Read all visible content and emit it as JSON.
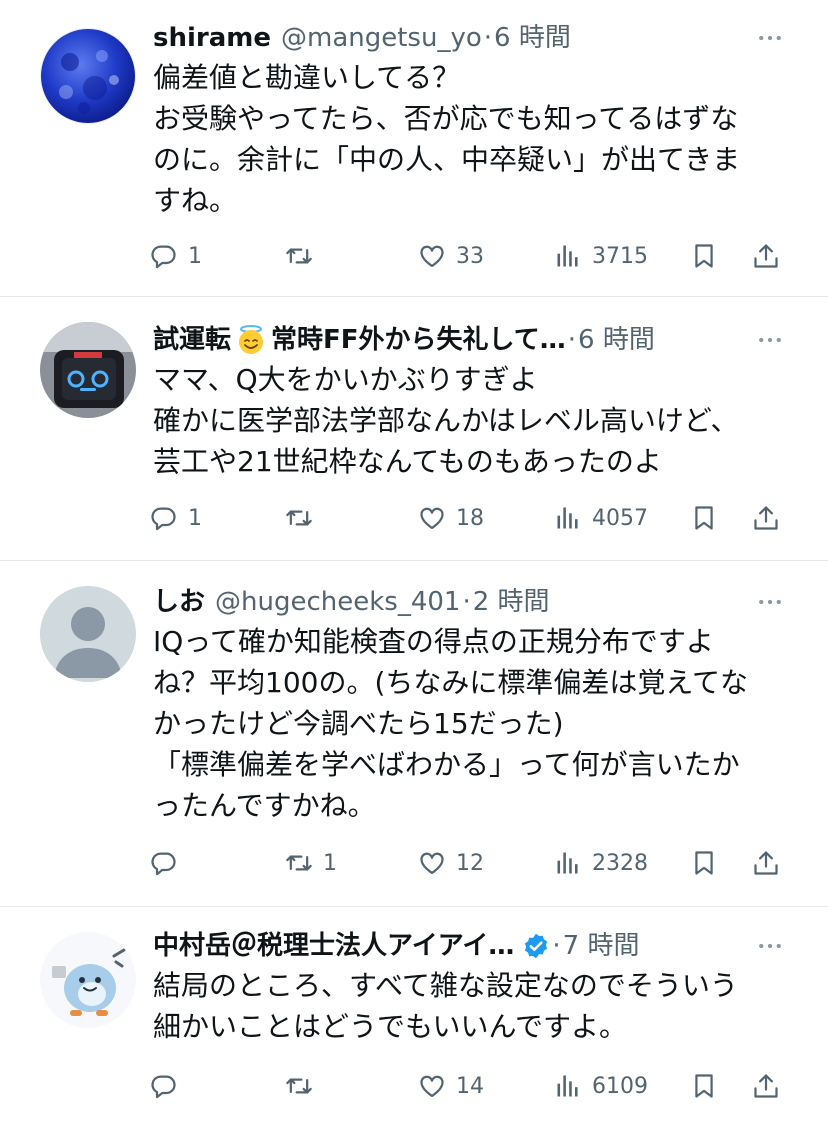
{
  "tweets": [
    {
      "name": "shirame",
      "handle": "@mangetsu_yo",
      "sep": "·",
      "time": "6 時間",
      "avatar_icon": "moon-avatar",
      "lines": [
        "偏差値と勘違いしてる？",
        "お受験やってたら、否が応でも知ってるはずな",
        "のに。余計に「中の人、中卒疑い」が出てきま",
        "すね。"
      ],
      "replies": "1",
      "retweets": "",
      "likes": "33",
      "views": "3715"
    },
    {
      "name": "試運転",
      "name_suffix": "常時FF外から失礼して…",
      "handle": "",
      "sep": "·",
      "time": "6 時間",
      "emoji_icon": "smiling-face-with-halo-icon",
      "avatar_icon": "robot-avatar",
      "lines": [
        "ママ、Q大をかいかぶりすぎよ",
        "確かに医学部法学部なんかはレベル高いけど、",
        "芸工や21世紀枠なんてものもあったのよ"
      ],
      "replies": "1",
      "retweets": "",
      "likes": "18",
      "views": "4057"
    },
    {
      "name": "しお",
      "handle": "@hugecheeks_401",
      "sep": "·",
      "time": "2 時間",
      "avatar_icon": "default-avatar",
      "lines": [
        "IQって確か知能検査の得点の正規分布ですよ",
        "ね？平均100の。(ちなみに標準偏差は覚えてな",
        "かったけど今調べたら15だった)",
        "「標準偏差を学べばわかる」って何が言いたか",
        "ったんですかね。"
      ],
      "replies": "",
      "retweets": "1",
      "likes": "12",
      "views": "2328"
    },
    {
      "name": "中村岳＠税理士法人アイアイ…",
      "handle": "",
      "sep": "·",
      "time": "7 時間",
      "verified_icon": "verified-badge-icon",
      "avatar_icon": "mascot-avatar",
      "lines": [
        "結局のところ、すべて雑な設定なのでそういう",
        "細かいことはどうでもいいんですよ。"
      ],
      "replies": "",
      "retweets": "",
      "likes": "14",
      "views": "6109"
    }
  ],
  "colors": {
    "text": "#0f1419",
    "muted": "#536471",
    "divider": "#e6e8ea",
    "verified": "#1d9bf0"
  }
}
